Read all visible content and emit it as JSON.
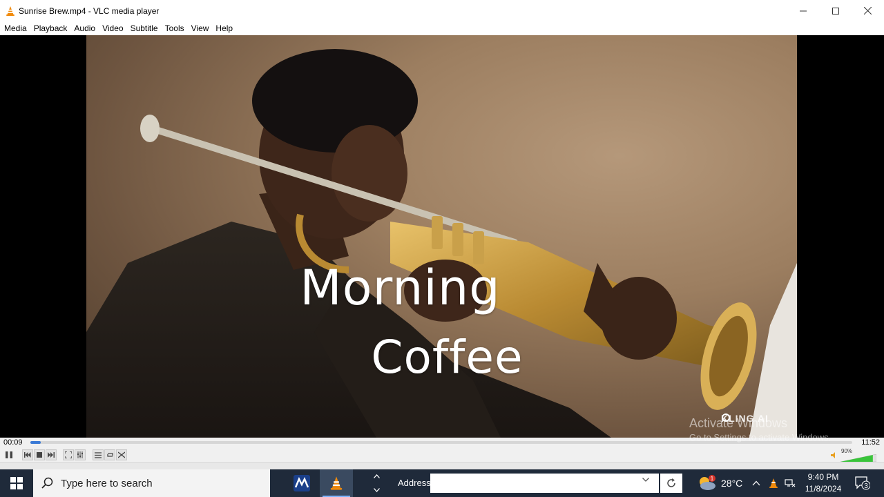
{
  "window": {
    "title": "Sunrise Brew.mp4 - VLC media player",
    "controls": {
      "minimize": "—",
      "maximize": "☐",
      "close": "✕"
    }
  },
  "menu": [
    "Media",
    "Playback",
    "Audio",
    "Video",
    "Subtitle",
    "Tools",
    "View",
    "Help"
  ],
  "video": {
    "subtitle_line1": "Morning",
    "subtitle_line2": "Coffee",
    "watermark": "KLING AI",
    "activate_title": "Activate Windows",
    "activate_subtitle": "Go to Settings to activate Windows."
  },
  "player": {
    "elapsed": "00:09",
    "total": "11:52",
    "progress_fraction": 0.013,
    "volume_label": "90%",
    "volume_fraction": 0.9
  },
  "controls": {
    "pause": "❚❚",
    "prev": "⏮",
    "stop": "■",
    "next": "⏭",
    "fullscreen": "⛶",
    "extended": "☷",
    "playlist": "☰",
    "loop": "⟲",
    "shuffle": "⤨"
  },
  "taskbar": {
    "search_placeholder": "Type here to search",
    "address_label": "Address",
    "address_value": "",
    "weather_temp": "28°C",
    "weather_badge": "1",
    "time": "9:40 PM",
    "date": "11/8/2024",
    "notification_count": "3",
    "colors": {
      "background": "#1f2a3a",
      "accent": "#7fb4ff"
    }
  }
}
